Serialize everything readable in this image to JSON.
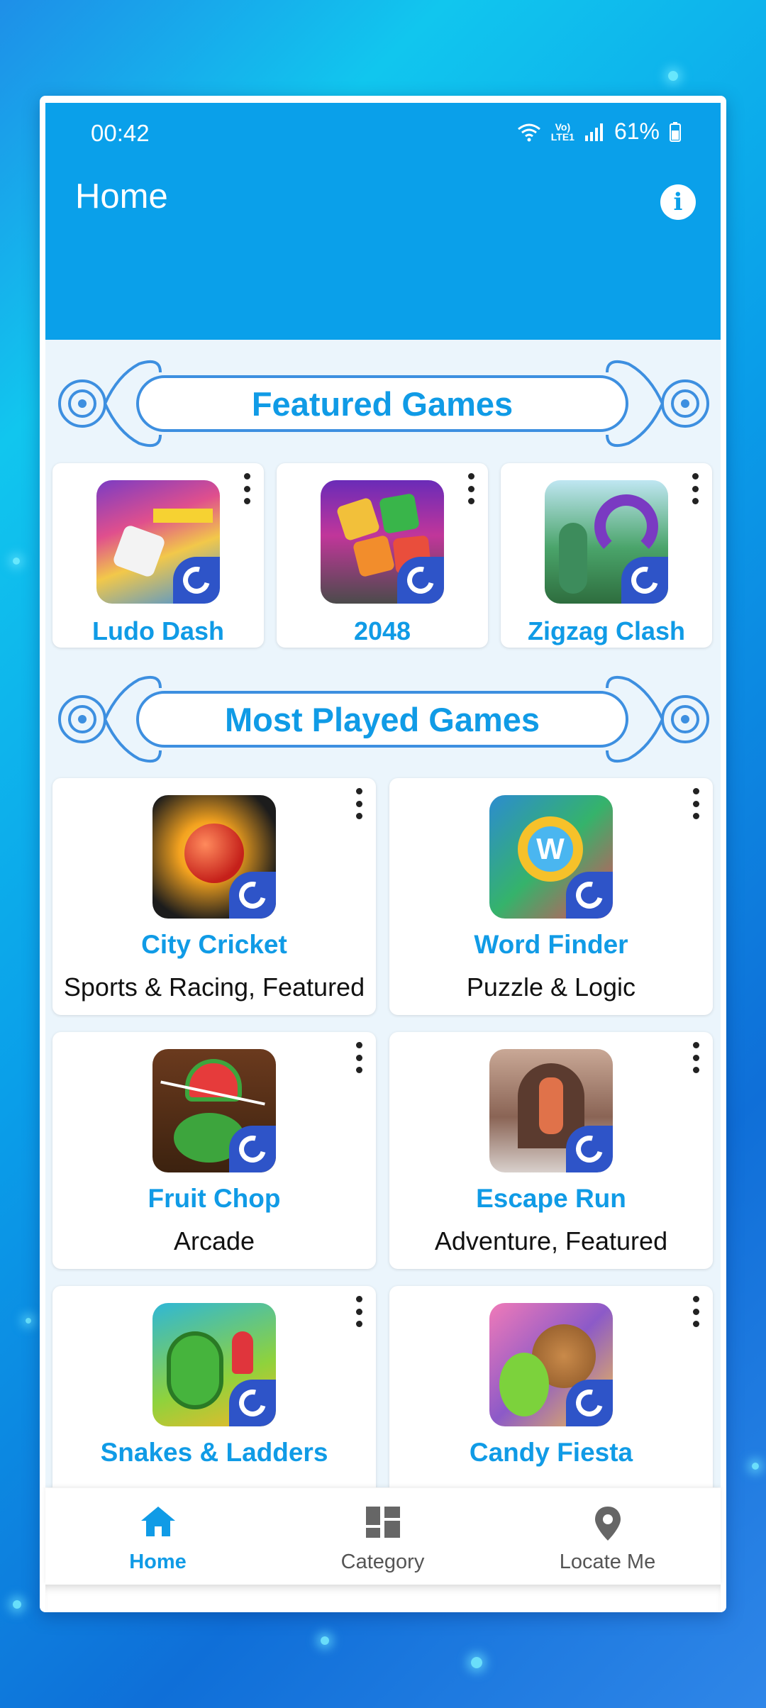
{
  "status_bar": {
    "time": "00:42",
    "battery": "61%"
  },
  "app_bar": {
    "title": "Home"
  },
  "featured": {
    "heading": "Featured Games",
    "items": [
      {
        "name": "Ludo Dash"
      },
      {
        "name": "2048"
      },
      {
        "name": "Zigzag Clash"
      }
    ]
  },
  "most_played": {
    "heading": "Most Played Games",
    "items": [
      {
        "name": "City Cricket",
        "category": "Sports & Racing, Featured"
      },
      {
        "name": "Word Finder",
        "category": "Puzzle & Logic"
      },
      {
        "name": "Fruit Chop",
        "category": "Arcade"
      },
      {
        "name": "Escape Run",
        "category": "Adventure, Featured"
      },
      {
        "name": "Snakes & Ladders",
        "category": ""
      },
      {
        "name": "Candy Fiesta",
        "category": ""
      }
    ]
  },
  "bottom_nav": {
    "items": [
      {
        "label": "Home",
        "icon": "home-icon",
        "active": true
      },
      {
        "label": "Category",
        "icon": "category-icon",
        "active": false
      },
      {
        "label": "Locate Me",
        "icon": "location-pin-icon",
        "active": false
      }
    ]
  },
  "colors": {
    "accent": "#0aa0ea",
    "heading_text": "#109be6",
    "badge": "#2e54c8"
  }
}
